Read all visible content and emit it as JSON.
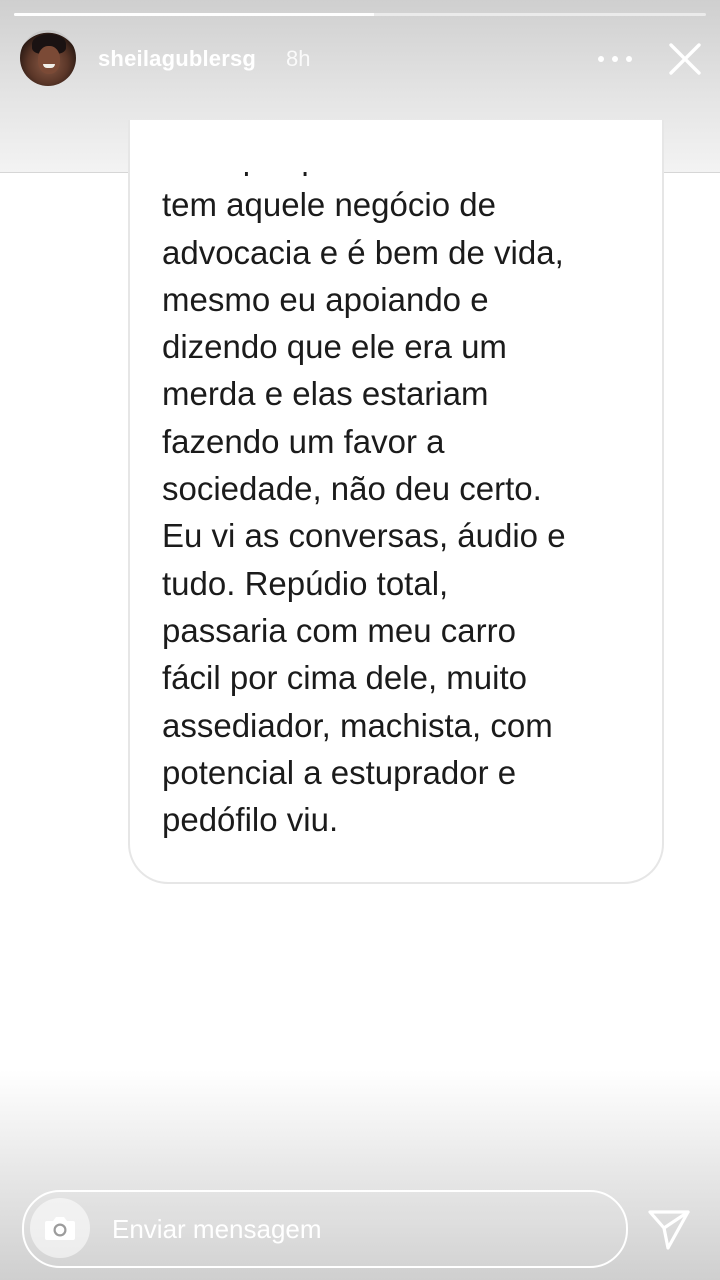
{
  "story": {
    "progress": 0.52
  },
  "header": {
    "username": "sheilagublersg",
    "time": "8h",
    "avatar_icon": "avatar-photo",
    "more_icon": "more-options-icon",
    "close_icon": "close-icon"
  },
  "message": {
    "text": "boas porque o bonito lá\ntem aquele negócio de\nadvocacia e é bem de vida,\nmesmo eu apoiando e\ndizendo que ele era um\nmerda e elas estariam\nfazendo um favor a\nsociedade, não deu certo.\nEu vi as conversas, áudio e\ntudo. Repúdio total,\npassaria com meu carro\nfácil por cima dele, muito\nassediador, machista, com\npotencial a estuprador e\npedófilo viu."
  },
  "footer": {
    "placeholder": "Enviar mensagem",
    "camera_icon": "camera-icon",
    "send_icon": "send-icon"
  }
}
